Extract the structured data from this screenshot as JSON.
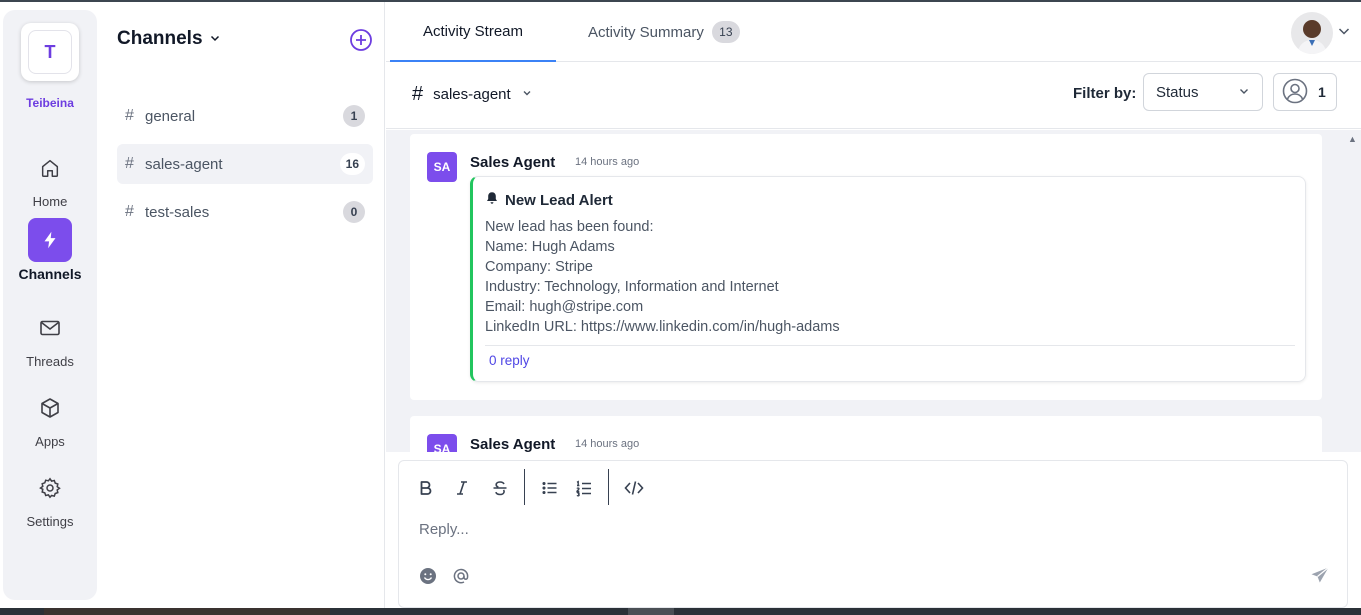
{
  "workspace": {
    "initial": "T",
    "name": "Teibeina"
  },
  "rail": [
    {
      "id": "home",
      "label": "Home",
      "icon": "home-icon",
      "active": false
    },
    {
      "id": "channels",
      "label": "Channels",
      "icon": "lightning-icon",
      "active": true
    },
    {
      "id": "threads",
      "label": "Threads",
      "icon": "mail-icon",
      "active": false
    },
    {
      "id": "apps",
      "label": "Apps",
      "icon": "cube-icon",
      "active": false
    },
    {
      "id": "settings",
      "label": "Settings",
      "icon": "gear-icon",
      "active": false
    }
  ],
  "channels_panel": {
    "title": "Channels",
    "items": [
      {
        "name": "general",
        "count": "1"
      },
      {
        "name": "sales-agent",
        "count": "16"
      },
      {
        "name": "test-sales",
        "count": "0"
      }
    ]
  },
  "tabs": [
    {
      "label": "Activity Stream"
    },
    {
      "label": "Activity Summary",
      "count": "13"
    }
  ],
  "filterbar": {
    "channel": "sales-agent",
    "filter_label": "Filter by:",
    "status_value": "Status",
    "user_count": "1"
  },
  "messages": [
    {
      "avatar": "SA",
      "sender": "Sales Agent",
      "time": "14 hours ago",
      "title": "New Lead Alert",
      "lines": [
        "New lead has been found:",
        "Name: Hugh Adams",
        "Company: Stripe",
        "Industry: Technology, Information and Internet",
        "Email: hugh@stripe.com",
        "LinkedIn URL: https://www.linkedin.com/in/hugh-adams"
      ],
      "reply": "0 reply"
    },
    {
      "avatar": "SA",
      "sender": "Sales Agent",
      "time": "14 hours ago"
    }
  ],
  "composer": {
    "placeholder": "Reply..."
  },
  "colors": {
    "accent": "#7c4dec",
    "tab_underline": "#3b82f6",
    "alert_border": "#22c55e",
    "link": "#4f46e5"
  }
}
